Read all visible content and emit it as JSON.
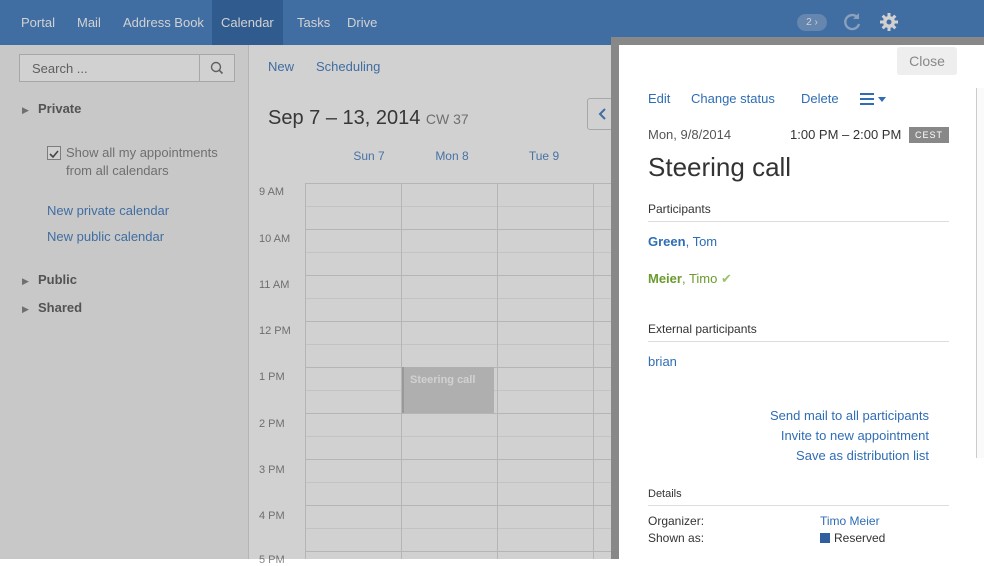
{
  "topbar": {
    "tabs": [
      {
        "label": "Portal"
      },
      {
        "label": "Mail"
      },
      {
        "label": "Address Book"
      },
      {
        "label": "Calendar"
      },
      {
        "label": "Tasks"
      },
      {
        "label": "Drive"
      }
    ],
    "notification_count": "2 ›",
    "refresh_icon": "refresh-icon",
    "settings_icon": "gear-icon"
  },
  "sidebar": {
    "search_placeholder": "Search ...",
    "private_label": "Private",
    "show_all_label_1": "Show all my appointments",
    "show_all_label_2": "from all calendars",
    "show_all_checked": true,
    "new_private": "New private calendar",
    "new_public": "New public calendar",
    "public_label": "Public",
    "shared_label": "Shared"
  },
  "toolbar": {
    "new_label": "New",
    "scheduling_label": "Scheduling"
  },
  "calendar": {
    "range_title": "Sep 7 – 13, 2014",
    "week_label": "CW 37",
    "days": [
      "Sun 7",
      "Mon 8",
      "Tue 9"
    ],
    "times": [
      "9 AM",
      "10 AM",
      "11 AM",
      "12 PM",
      "1 PM",
      "2 PM",
      "3 PM",
      "4 PM",
      "5 PM"
    ],
    "appointment_title": "Steering call"
  },
  "popup": {
    "close_label": "Close",
    "actions": {
      "edit": "Edit",
      "change_status": "Change status",
      "delete": "Delete"
    },
    "date": "Mon, 9/8/2014",
    "time": "1:00 PM – 2:00 PM",
    "timezone": "CEST",
    "title": "Steering call",
    "participants_heading": "Participants",
    "participants": [
      {
        "last": "Green",
        "first": ", Tom",
        "color": "#2f6db5"
      },
      {
        "last": "Meier",
        "first": ", Timo",
        "color": "#6b9b2f",
        "accepted": "✔"
      }
    ],
    "external_heading": "External participants",
    "external": [
      "brian"
    ],
    "links": {
      "send_mail": "Send mail to all participants",
      "invite": "Invite to new appointment",
      "save_list": "Save as distribution list"
    },
    "details_heading": "Details",
    "details": {
      "organizer_label": "Organizer:",
      "organizer_value": "Timo Meier",
      "shown_as_label": "Shown as:",
      "shown_as_value": "Reserved"
    }
  }
}
